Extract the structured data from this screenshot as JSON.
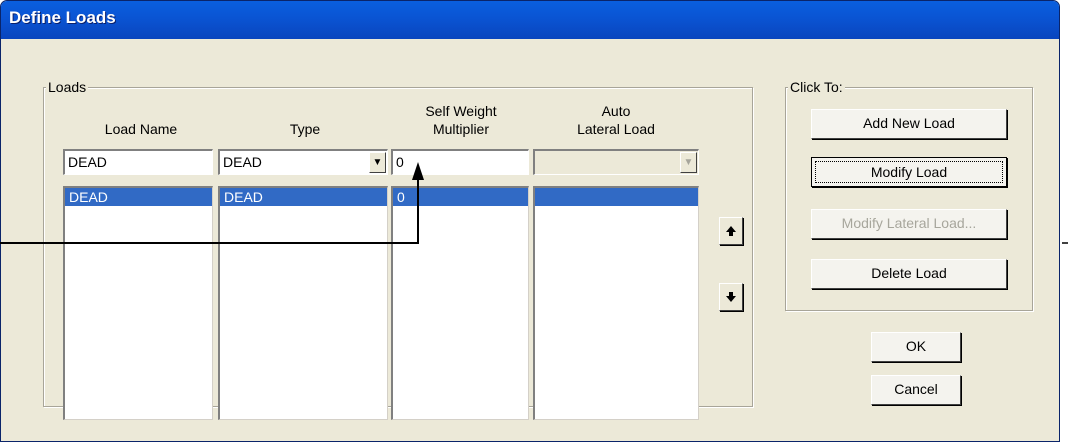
{
  "window": {
    "title": "Define Loads"
  },
  "loads_group": {
    "label": "Loads",
    "headers": {
      "load_name": "Load Name",
      "type": "Type",
      "self_weight_line1": "Self Weight",
      "self_weight_line2": "Multiplier",
      "auto_line1": "Auto",
      "auto_line2": "Lateral Load"
    },
    "inputs": {
      "load_name": "DEAD",
      "type": "DEAD",
      "self_weight": "0",
      "auto_lateral": ""
    },
    "rows": [
      {
        "name": "DEAD",
        "type": "DEAD",
        "multiplier": "0",
        "auto_lateral": ""
      }
    ]
  },
  "click_to_group": {
    "label": "Click To:",
    "add_new_load": "Add New Load",
    "modify_load": "Modify Load",
    "modify_lateral_load": "Modify Lateral Load...",
    "delete_load": "Delete Load"
  },
  "buttons": {
    "ok": "OK",
    "cancel": "Cancel"
  },
  "icons": {
    "move_up": "arrow-up-icon",
    "move_down": "arrow-down-icon",
    "dropdown": "chevron-down-icon"
  },
  "colors": {
    "title_bar": "#0a54d3",
    "selection": "#316ac5",
    "dialog_bg": "#ece9d8"
  }
}
